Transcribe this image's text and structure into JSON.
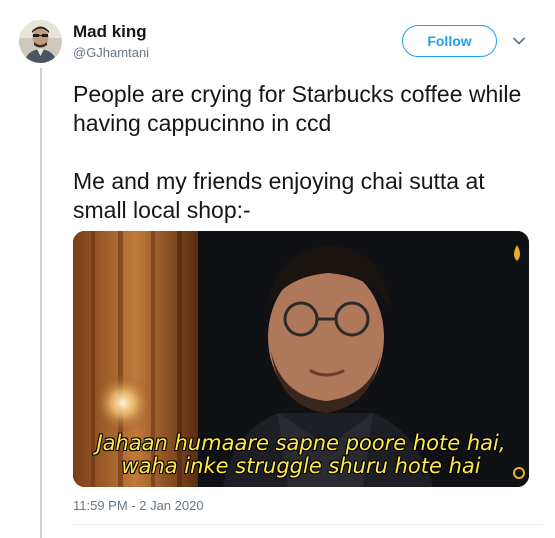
{
  "author": {
    "name": "Mad king",
    "handle": "@GJhamtani"
  },
  "actions": {
    "follow_label": "Follow",
    "menu_icon": "chevron-down-icon"
  },
  "tweet": {
    "paragraph_1": "People are crying for Starbucks coffee while having cappucinno in ccd",
    "paragraph_2": "Me and my friends enjoying chai sutta at small local shop:-"
  },
  "media": {
    "subtitle_line_1": "Jahaan humaare sapne poore hote hai,",
    "subtitle_line_2": "waha inke struggle shuru hote hai",
    "watermark_icon": "drop-logo-icon"
  },
  "meta": {
    "timestamp": "11:59 PM - 2 Jan 2020"
  },
  "colors": {
    "accent": "#1da1f2",
    "text": "#14171a",
    "muted": "#657786",
    "subtitle": "#ffe94a"
  }
}
